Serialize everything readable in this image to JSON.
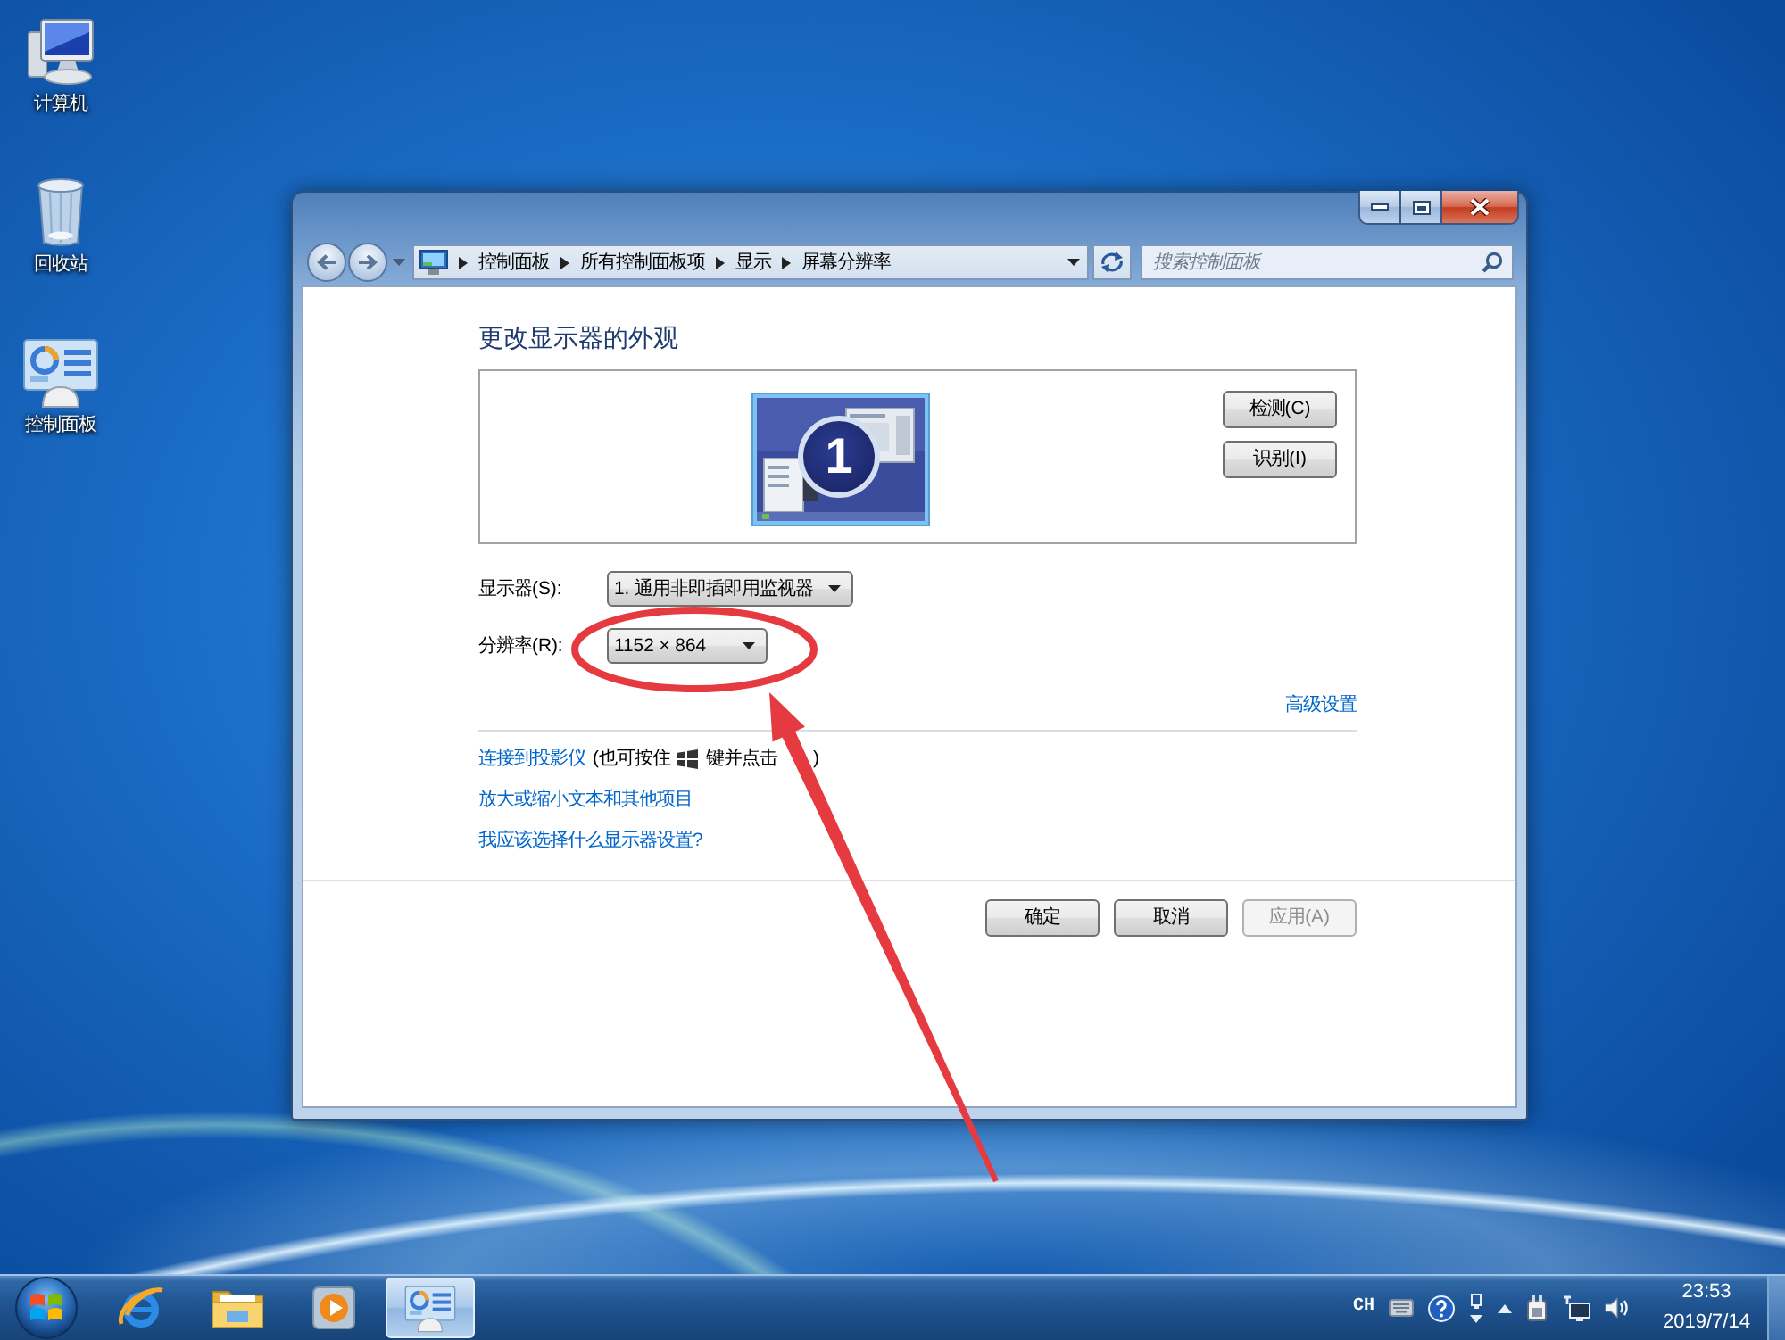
{
  "desktop": {
    "icons": [
      {
        "label": "计算机",
        "kind": "computer"
      },
      {
        "label": "回收站",
        "kind": "recycle_bin"
      },
      {
        "label": "控制面板",
        "kind": "control_panel"
      }
    ]
  },
  "window": {
    "address_bar": {
      "crumbs": [
        "控制面板",
        "所有控制面板项",
        "显示",
        "屏幕分辨率"
      ]
    },
    "search": {
      "placeholder": "搜索控制面板"
    },
    "heading": "更改显示器的外观",
    "preview": {
      "monitor_number": "1",
      "buttons": [
        "检测(C)",
        "识别(I)"
      ]
    },
    "settings": [
      {
        "label": "显示器(S):",
        "value": "1. 通用非即插即用监视器"
      },
      {
        "label": "分辨率(R):",
        "value": "1152 × 864"
      }
    ],
    "advanced_link": "高级设置",
    "links": [
      {
        "text": "连接到投影仪",
        "note": {
          "before_key": "(也可按住",
          "after_key": "键并点击",
          "end": ")"
        }
      },
      {
        "text": "放大或缩小文本和其他项目"
      },
      {
        "text": "我应该选择什么显示器设置?"
      }
    ],
    "buttons": [
      {
        "label": "确定",
        "disabled": false
      },
      {
        "label": "取消",
        "disabled": false
      },
      {
        "label": "应用(A)",
        "disabled": true
      }
    ]
  },
  "taskbar": {
    "apps": [
      {
        "kind": "browser",
        "selected": false
      },
      {
        "kind": "folder",
        "selected": false
      },
      {
        "kind": "media_player",
        "selected": false
      },
      {
        "kind": "control_panel",
        "selected": true
      }
    ],
    "language": "CH",
    "clock": {
      "time": "23:53",
      "date": "2019/7/14"
    }
  },
  "annotations": {
    "ellipse": true,
    "arrow": true
  }
}
